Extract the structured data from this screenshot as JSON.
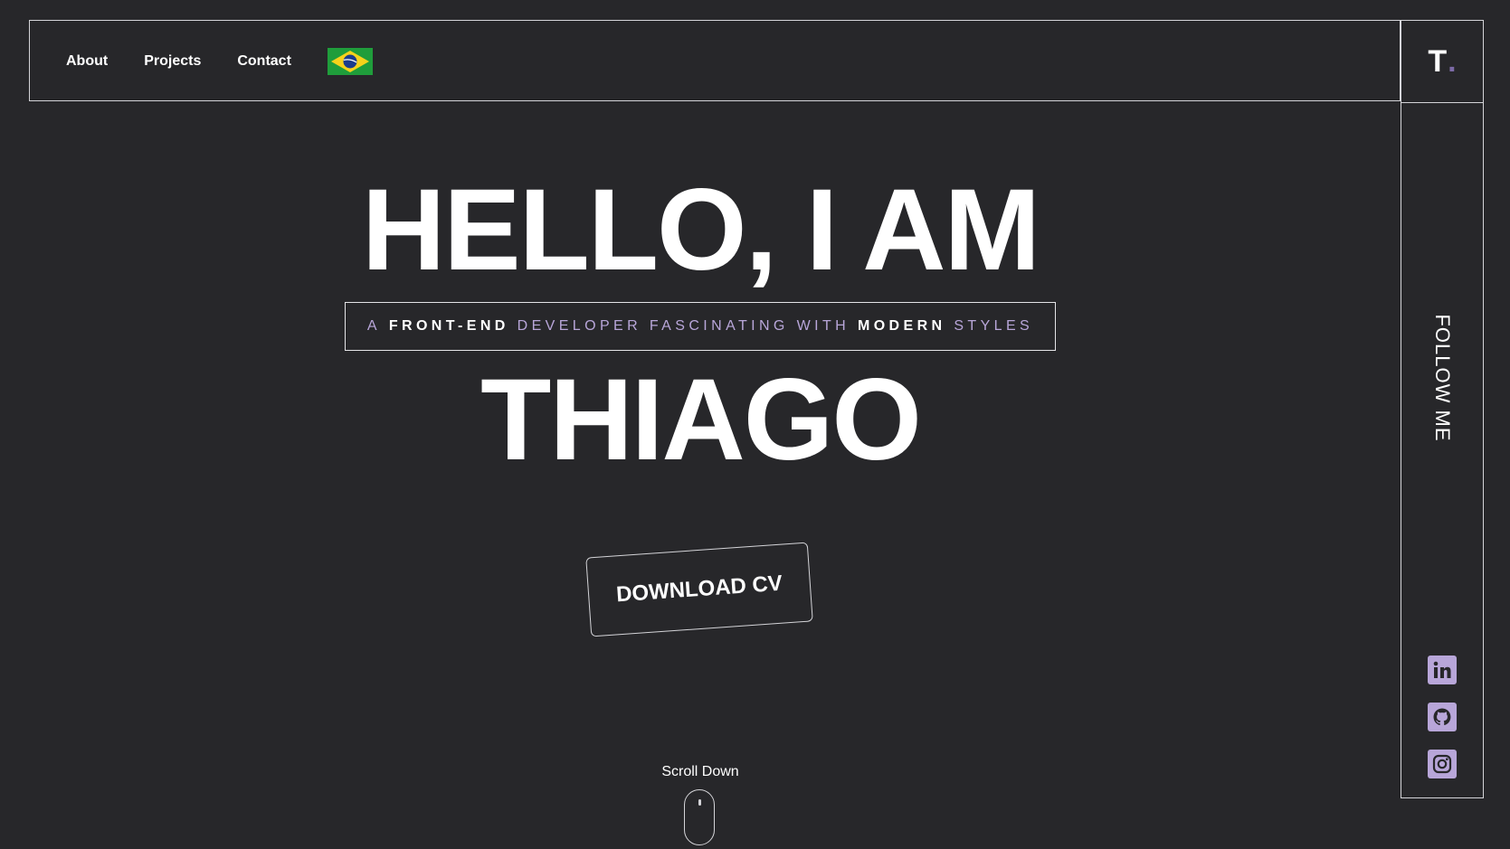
{
  "nav": {
    "about": "About",
    "projects": "Projects",
    "contact": "Contact",
    "language_flag": "brazil-flag-icon"
  },
  "logo": {
    "letter": "T",
    "dot": "."
  },
  "hero": {
    "line1": "HELLO, I AM",
    "tagline": {
      "a": "A",
      "front_end": "FRONT-END",
      "middle": "DEVELOPER FASCINATING WITH",
      "modern": "MODERN",
      "end": "STYLES"
    },
    "line2": "THIAGO",
    "cta": "DOWNLOAD CV"
  },
  "scroll": {
    "label": "Scroll Down"
  },
  "sidebar": {
    "follow_label": "FOLLOW ME",
    "socials": [
      {
        "icon": "linkedin-icon"
      },
      {
        "icon": "github-icon"
      },
      {
        "icon": "instagram-icon"
      }
    ]
  },
  "colors": {
    "background": "#27272a",
    "accent": "#b8a6d9",
    "border": "#d4d4d8",
    "text": "#ffffff"
  }
}
